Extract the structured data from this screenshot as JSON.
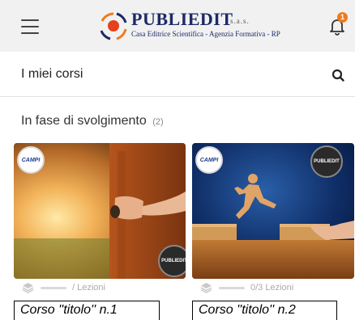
{
  "header": {
    "menu_icon": "hamburger-menu-icon",
    "logo": {
      "title": "PUBLIEDIT",
      "suffix": "s.a.s.",
      "subtitle": "Casa Editrice Scientifica - Agenzia Formativa - RP"
    },
    "notifications": {
      "icon": "bell-icon",
      "count": "1",
      "badge_color": "#f07a1a"
    }
  },
  "page": {
    "title": "I miei corsi",
    "search_icon": "search-icon"
  },
  "section": {
    "title": "In fase di svolgimento",
    "count": "(2)"
  },
  "courses": [
    {
      "image": "door-handle-sunset",
      "badge_left": "CAMPI",
      "badge_right": "PUBLIEDIT",
      "lessons": "/ Lezioni",
      "title": "Corso ''titolo'' n.1"
    },
    {
      "image": "figure-jumping-between-blocks",
      "badge_left": "CAMPI",
      "badge_right": "PUBLIEDIT",
      "lessons": "0/3 Lezioni",
      "title": "Corso ''titolo'' n.2"
    }
  ],
  "colors": {
    "header_bg": "#f1f1f1",
    "brand_blue": "#1d2a66",
    "accent_orange": "#f07a1a"
  }
}
